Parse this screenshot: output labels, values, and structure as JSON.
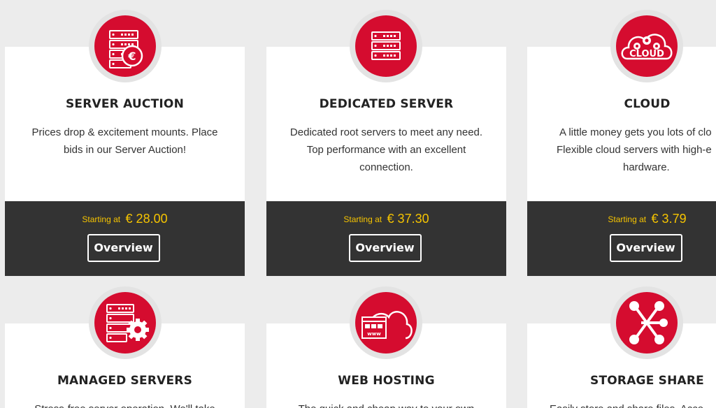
{
  "cards": [
    {
      "title": "SERVER AUCTION",
      "desc_lines": [
        "Prices drop & excitement mounts. Place",
        "bids in our Server Auction!"
      ],
      "price_label": "Starting at",
      "price": "€ 28.00",
      "button": "Overview"
    },
    {
      "title": "DEDICATED SERVER",
      "desc_lines": [
        "Dedicated root servers to meet any need.",
        "Top performance with an excellent",
        "connection."
      ],
      "price_label": "Starting at",
      "price": "€ 37.30",
      "button": "Overview"
    },
    {
      "title": "CLOUD",
      "desc_lines": [
        "A little money gets you lots of clo",
        "Flexible cloud servers with high-e",
        "hardware."
      ],
      "price_label": "Starting at",
      "price": "€ 3.79",
      "button": "Overview",
      "icon_text": "CLOUD"
    },
    {
      "title": "MANAGED SERVERS",
      "desc_lines": [
        "Stress-free server operation. We'll take"
      ]
    },
    {
      "title": "WEB HOSTING",
      "desc_lines": [
        "The quick and cheap way to your own"
      ]
    },
    {
      "title": "STORAGE SHARE",
      "desc_lines": [
        "Easily store and share files. Acce"
      ]
    }
  ],
  "icons": [
    "server-auction-icon",
    "dedicated-server-icon",
    "cloud-gears-icon",
    "managed-server-gear-icon",
    "web-hosting-cloud-icon",
    "storage-share-icon"
  ],
  "colors": {
    "accent": "#d50c2f",
    "price": "#f6c400",
    "footer": "#333333",
    "background": "#ececec"
  }
}
